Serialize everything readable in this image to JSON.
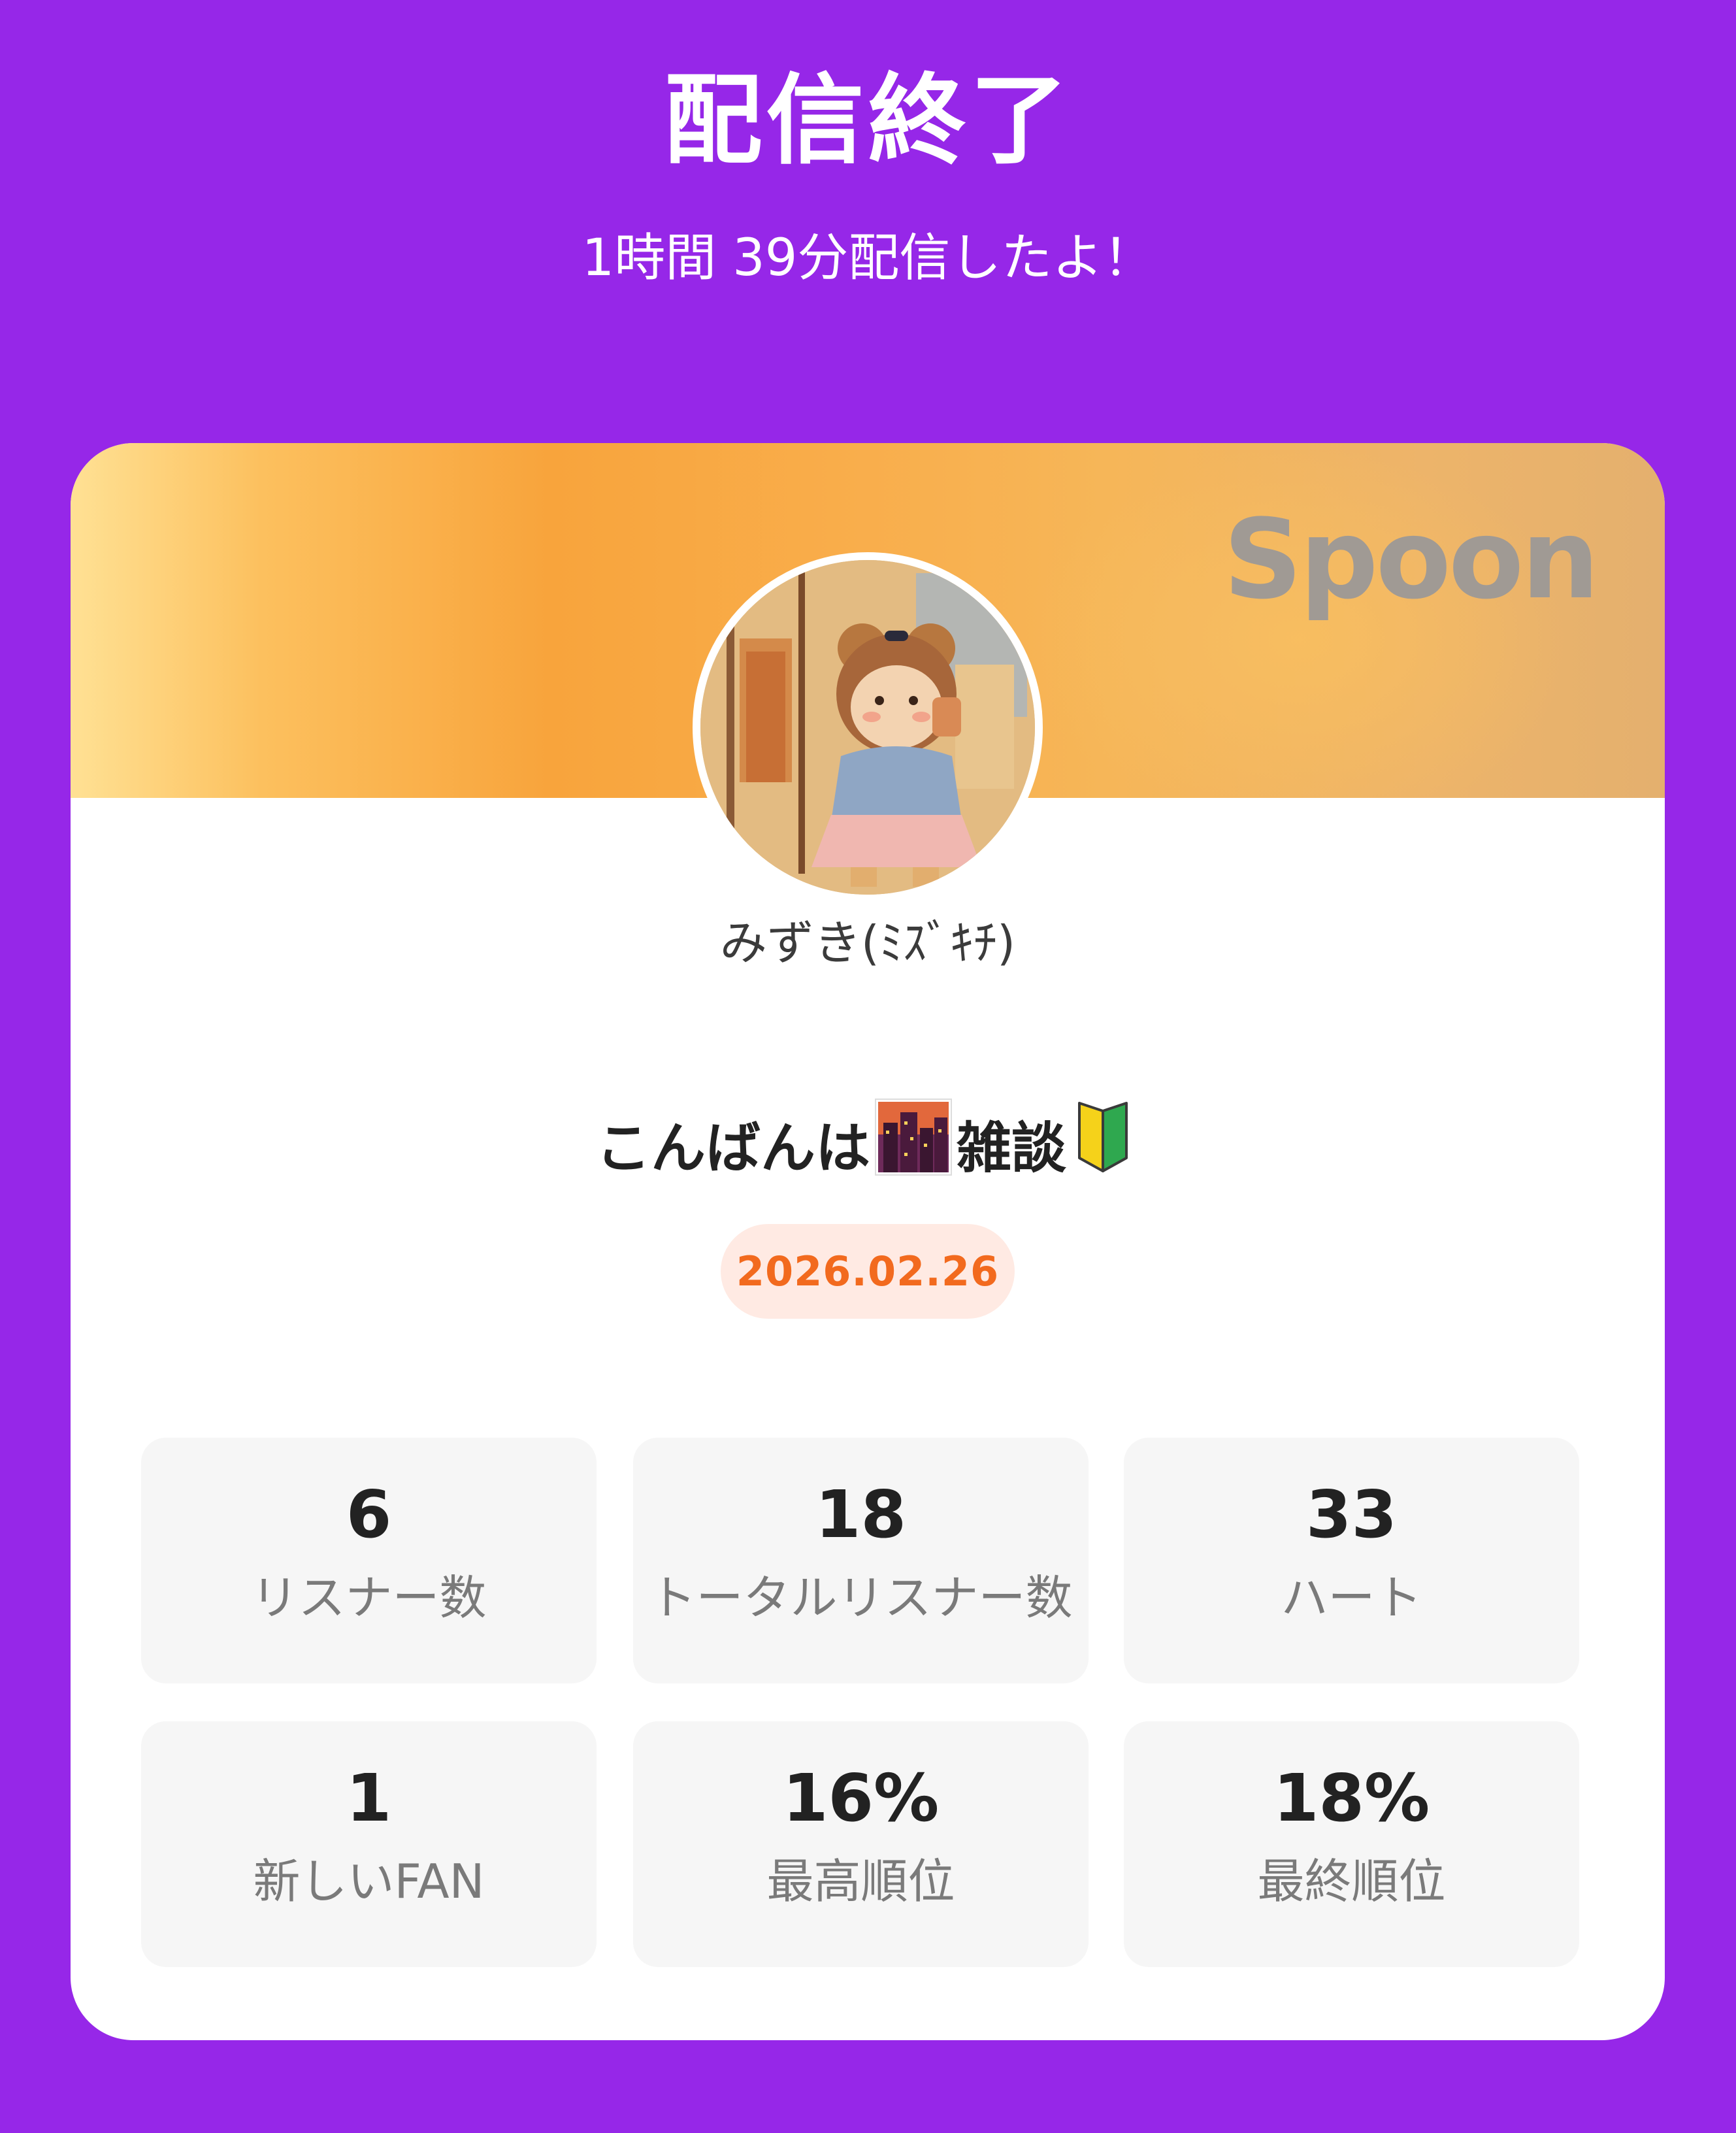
{
  "header": {
    "title": "配信終了",
    "subtitle": "1時間 39分配信したよ！"
  },
  "card": {
    "brand": "Spoon",
    "username": "みずき(ﾐｽﾞｷﾁ)",
    "live_title_part1": "こんばんは",
    "live_title_part2": "雑談",
    "emoji_icons": [
      "city-dusk-icon",
      "beginner-mark-icon"
    ],
    "date": "2026.02.26"
  },
  "stats": [
    {
      "value": "6",
      "label": "リスナー数"
    },
    {
      "value": "18",
      "label": "トータルリスナー数"
    },
    {
      "value": "33",
      "label": "ハート"
    },
    {
      "value": "1",
      "label": "新しいFAN"
    },
    {
      "value": "16%",
      "label": "最高順位"
    },
    {
      "value": "18%",
      "label": "最終順位"
    }
  ],
  "colors": {
    "background": "#9627E8",
    "date_text": "#F26A1E",
    "date_pill": "#FFEAE3",
    "stat_box": "#F6F6F6"
  }
}
